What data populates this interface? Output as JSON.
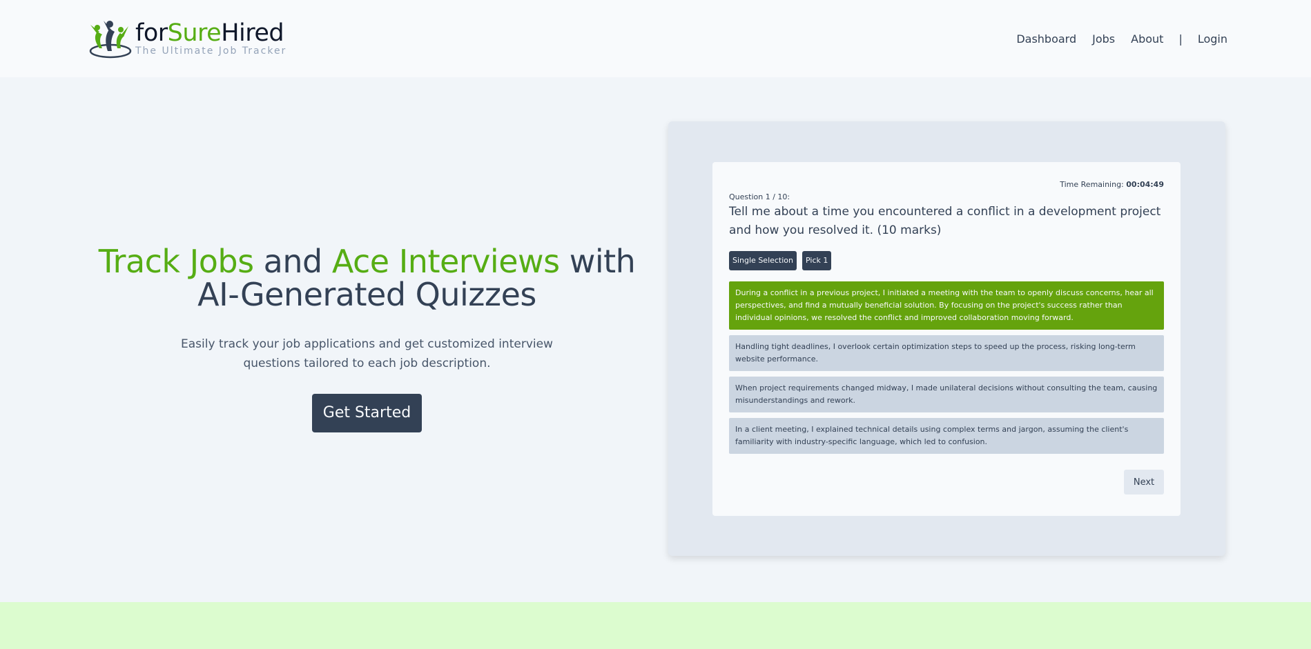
{
  "colors": {
    "accent_green": "#56ad14",
    "selected_option": "#65a30d",
    "dark": "#334155",
    "band": "#dcfccf"
  },
  "logo": {
    "icon": "people-celebrating-icon",
    "brand_for": "for",
    "brand_sure": "Sure",
    "brand_hired": "Hired",
    "tagline": "The Ultimate Job Tracker"
  },
  "nav": {
    "dashboard": "Dashboard",
    "jobs": "Jobs",
    "about": "About",
    "separator": "|",
    "login": "Login"
  },
  "hero": {
    "title_part1": "Track Jobs",
    "title_part2": " and ",
    "title_part3": "Ace Interviews",
    "title_part4": " with AI-Generated Quizzes",
    "subtitle": "Easily track your job applications and get customized interview questions tailored to each job description.",
    "cta": "Get Started"
  },
  "quiz": {
    "timer_label": "Time Remaining: ",
    "timer_value": "00:04:49",
    "question_number": "Question 1 / 10:",
    "question": "Tell me about a time you encountered a conflict in a development project and how you resolved it. (10 marks)",
    "tags": [
      "Single Selection",
      "Pick 1"
    ],
    "options": [
      "During a conflict in a previous project, I initiated a meeting with the team to openly discuss concerns, hear all perspectives, and find a mutually beneficial solution. By focusing on the project's success rather than individual opinions, we resolved the conflict and improved collaboration moving forward.",
      "Handling tight deadlines, I overlook certain optimization steps to speed up the process, risking long-term website performance.",
      "When project requirements changed midway, I made unilateral decisions without consulting the team, causing misunderstandings and rework.",
      "In a client meeting, I explained technical details using complex terms and jargon, assuming the client's familiarity with industry-specific language, which led to confusion."
    ],
    "selected_option": 0,
    "next_label": "Next"
  }
}
